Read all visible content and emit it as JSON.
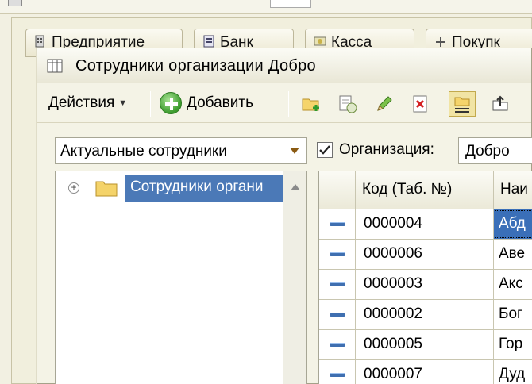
{
  "background_tabs": [
    {
      "label": "Предприятие",
      "icon": "enterprise-icon"
    },
    {
      "label": "Банк",
      "icon": "bank-icon"
    },
    {
      "label": "Касса",
      "icon": "cash-icon"
    },
    {
      "label": "Покупк",
      "icon": "purchases-icon"
    }
  ],
  "window": {
    "title": "Сотрудники организации Добро",
    "title_icon": "table-list-icon"
  },
  "toolbar": {
    "actions_label": "Действия",
    "add_label": "Добавить",
    "icons": [
      "new-folder-icon",
      "copy-icon",
      "edit-pencil-icon",
      "delete-icon",
      "hierarchy-view-icon",
      "move-to-folder-icon"
    ]
  },
  "filter": {
    "selected": "Актуальные сотрудники",
    "organization_checked": true,
    "organization_label": "Организация:",
    "organization_value": "Добро"
  },
  "tree": {
    "root_label": "Сотрудники органи"
  },
  "table": {
    "columns": [
      "",
      "Код (Таб. №)",
      "Наи"
    ],
    "rows": [
      {
        "code": "0000004",
        "name": "Абд",
        "selected": true
      },
      {
        "code": "0000006",
        "name": "Аве",
        "selected": false
      },
      {
        "code": "0000003",
        "name": "Акс",
        "selected": false
      },
      {
        "code": "0000002",
        "name": "Бог",
        "selected": false
      },
      {
        "code": "0000005",
        "name": "Гор",
        "selected": false
      },
      {
        "code": "0000007",
        "name": "Дуд",
        "selected": false
      }
    ]
  },
  "colors": {
    "selection": "#3a6fb8",
    "tree_selection": "#4b79b7",
    "window_bg": "#f4f3e6"
  }
}
